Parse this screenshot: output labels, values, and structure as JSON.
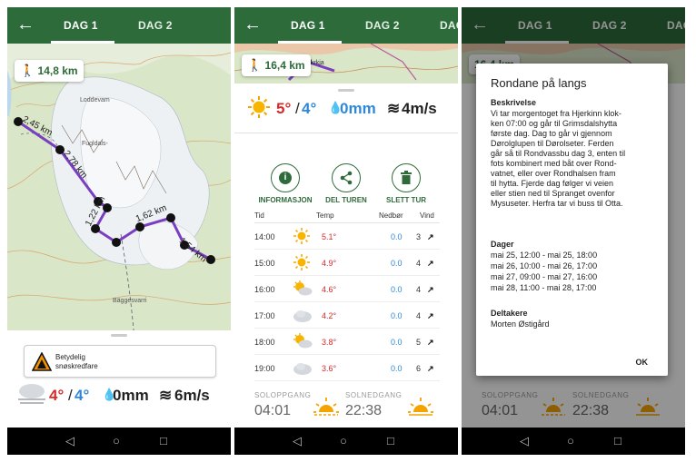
{
  "tabs": {
    "back": "←",
    "day1": "DAG 1",
    "day2": "DAG 2",
    "day3_partial": "DAG"
  },
  "screen1": {
    "distance_chip": "14,8 km",
    "map_labels": {
      "place1": "Loddevam",
      "place2": "Fugldals-",
      "place3": "Bäggesvarri"
    },
    "segments": [
      "2,45 km",
      "2,78 km",
      "1,22 km",
      "1,62 km",
      "1,54 km"
    ],
    "warning": {
      "line1": "Betydelig",
      "line2": "snøskredfare"
    },
    "weather": {
      "temp_high": "4°",
      "sep": "/",
      "temp_low": "4°",
      "precip": "0mm",
      "wind": "6m/s"
    }
  },
  "screen2": {
    "distance_chip": "16,4 km",
    "map_label": "ekrkja",
    "weather": {
      "temp_high": "5°",
      "sep": "/",
      "temp_low": "4°",
      "precip": "0mm",
      "wind": "4m/s"
    },
    "actions": [
      {
        "label": "INFORMASJON",
        "icon": "info-icon"
      },
      {
        "label": "DEL TUREN",
        "icon": "share-icon"
      },
      {
        "label": "SLETT TUR",
        "icon": "trash-icon"
      }
    ],
    "table_headers": {
      "time": "Tid",
      "temp": "Temp",
      "precip": "Nedbør",
      "wind": "Vind"
    },
    "rows": [
      {
        "time": "14:00",
        "icon": "sun-icon",
        "temp": "5.1°",
        "precip": "0.0",
        "wind": "3",
        "arrow": "↗"
      },
      {
        "time": "15:00",
        "icon": "sun-icon",
        "temp": "4.9°",
        "precip": "0.0",
        "wind": "4",
        "arrow": "↗"
      },
      {
        "time": "16:00",
        "icon": "partly-cloudy-icon",
        "temp": "4.6°",
        "precip": "0.0",
        "wind": "4",
        "arrow": "↗"
      },
      {
        "time": "17:00",
        "icon": "cloudy-icon",
        "temp": "4.2°",
        "precip": "0.0",
        "wind": "4",
        "arrow": "↗"
      },
      {
        "time": "18:00",
        "icon": "partly-cloudy-icon",
        "temp": "3.8°",
        "precip": "0.0",
        "wind": "5",
        "arrow": "↗"
      },
      {
        "time": "19:00",
        "icon": "cloudy-icon",
        "temp": "3.6°",
        "precip": "0.0",
        "wind": "6",
        "arrow": "↗"
      }
    ],
    "sunrise": {
      "label": "SOLOPPGANG",
      "time": "04:01"
    },
    "sunset": {
      "label": "SOLNEDGANG",
      "time": "22:38"
    }
  },
  "screen3": {
    "bg_sunrise": {
      "label": "SOLOPPGANG",
      "time": "04:01"
    },
    "bg_sunset": {
      "label": "SOLNEDGANG",
      "time": "22:38"
    },
    "bg_chip": "16,4 km",
    "dialog": {
      "title": "Rondane på langs",
      "desc_heading": "Beskrivelse",
      "desc_text": "Vi tar morgentoget fra Hjerkinn klok-\nken 07:00 og går til Grimsdalshytta\nførste dag. Dag to går vi gjennom\nDørolglupen til Dørolseter. Ferden\ngår så til Rondvassbu dag 3, enten til\nfots kombinert med båt over Rond-\nvatnet, eller over Rondhalsen fram\ntil hytta. Fjerde dag følger vi veien\neller stien ned til Spranget ovenfor\nMysuseter. Herfra tar vi buss til Otta.",
      "days_heading": "Dager",
      "days": [
        "mai 25, 12:00 - mai 25, 18:00",
        "mai 26, 10:00 - mai 26, 17:00",
        "mai 27, 09:00 - mai 27, 16:00",
        "mai 28, 11:00 - mai 28, 17:00"
      ],
      "participants_heading": "Deltakere",
      "participants": "Morten Østigård",
      "ok": "OK"
    }
  },
  "nav": {
    "back": "◁",
    "home": "○",
    "recents": "□"
  }
}
